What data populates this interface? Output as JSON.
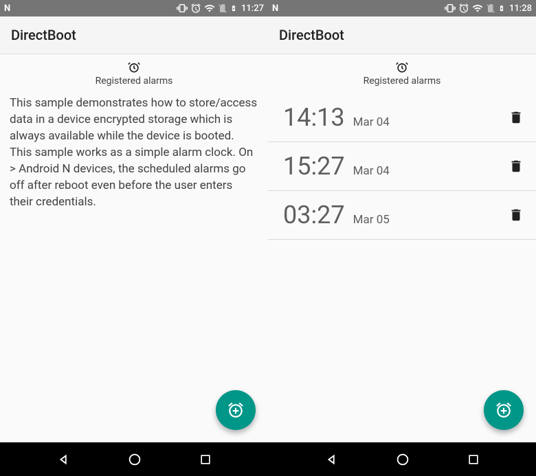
{
  "left": {
    "status_time": "11:27",
    "app_title": "DirectBoot",
    "section_title": "Registered alarms",
    "description": "This sample demonstrates how to store/access data in a device encrypted storage which is always available while the device is booted. This sample works as a simple alarm clock. On > Android N devices, the scheduled alarms go off after reboot even before the user enters their credentials."
  },
  "right": {
    "status_time": "11:28",
    "app_title": "DirectBoot",
    "section_title": "Registered alarms",
    "alarms": [
      {
        "time": "14:13",
        "date": "Mar 04"
      },
      {
        "time": "15:27",
        "date": "Mar 04"
      },
      {
        "time": "03:27",
        "date": "Mar 05"
      }
    ]
  }
}
